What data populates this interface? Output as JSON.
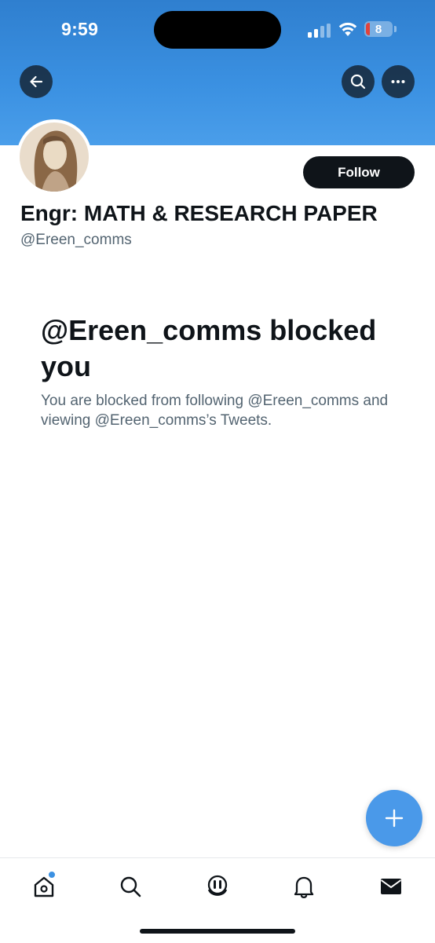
{
  "status_bar": {
    "time": "9:59",
    "battery_level": "8",
    "battery_color": "#e0433d"
  },
  "header": {
    "back_icon": "arrow-left-icon",
    "search_icon": "search-icon",
    "more_icon": "more-horizontal-icon",
    "banner_color": "#3b91e2"
  },
  "profile": {
    "display_name": "Engr: MATH & RESEARCH PAPER",
    "handle": "@Ereen_comms",
    "follow_label": "Follow"
  },
  "blocked": {
    "title": "@Ereen_comms blocked you",
    "body": "You are blocked from following @Ereen_comms and viewing @Ereen_comms’s Tweets."
  },
  "compose": {
    "icon": "plus-icon",
    "color": "#4a99e9"
  },
  "tab_bar": {
    "items": [
      {
        "icon": "home-icon",
        "has_notification_dot": true
      },
      {
        "icon": "search-icon"
      },
      {
        "icon": "spaces-icon"
      },
      {
        "icon": "bell-icon"
      },
      {
        "icon": "mail-icon"
      }
    ]
  }
}
